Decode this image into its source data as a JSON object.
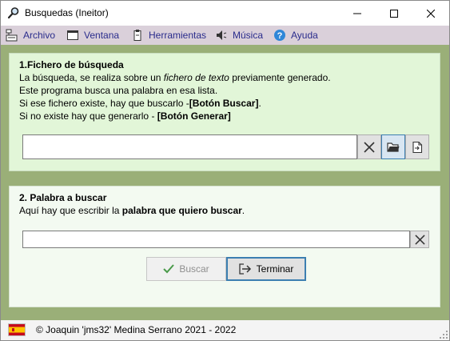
{
  "window": {
    "title": "Busquedas (Ineitor)",
    "controls": [
      "minimize",
      "maximize",
      "close"
    ]
  },
  "menu": {
    "items": [
      {
        "label": "Archivo",
        "icon": "archive-icon"
      },
      {
        "label": "Ventana",
        "icon": "window-icon"
      },
      {
        "label": "Herramientas",
        "icon": "tools-icon"
      },
      {
        "label": "Música",
        "icon": "speaker-icon"
      },
      {
        "label": "Ayuda",
        "icon": "help-icon"
      }
    ]
  },
  "panel1": {
    "title": "1.Fichero de búsqueda",
    "line1_a": "La búsqueda, se realiza sobre un ",
    "line1_b": "fichero de texto",
    "line1_c": " previamente generado.",
    "line2": "Este programa busca una palabra en esa lista.",
    "line3_a": "Si ese fichero existe, hay que buscarlo -",
    "line3_b": "[Botón Buscar]",
    "line3_c": ".",
    "line4_a": "Si no existe hay que generarlo - ",
    "line4_b": "[Botón Generar]",
    "file_value": ""
  },
  "panel2": {
    "title": "2. Palabra a buscar",
    "desc_a": "Aquí hay que escribir la ",
    "desc_b": "palabra que quiero buscar",
    "desc_c": ".",
    "word_value": "",
    "search_label": "Buscar",
    "finish_label": "Terminar"
  },
  "status": {
    "copyright": "© Joaquin 'jms32' Medina Serrano 2021 - 2022"
  },
  "colors": {
    "menubar": "#dad0da",
    "menu_text": "#2a2c8c",
    "content_bg": "#9aaf78",
    "panel1_bg": "#e2f6d8",
    "panel2_bg": "#f3faf1"
  }
}
